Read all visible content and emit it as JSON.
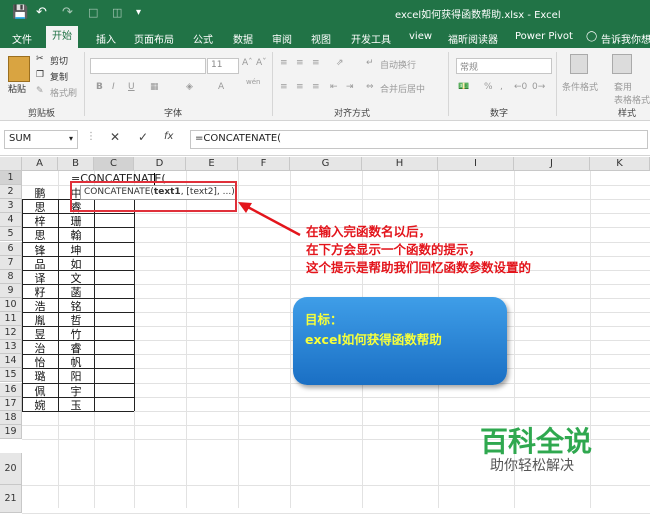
{
  "titlebar": {
    "title": "excel如何获得函数帮助.xlsx - Excel"
  },
  "tabs": [
    "文件",
    "开始",
    "插入",
    "页面布局",
    "公式",
    "数据",
    "审阅",
    "视图",
    "开发工具",
    "view",
    "福昕阅读器",
    "Power Pivot",
    "告诉我你想要"
  ],
  "active_tab": "开始",
  "ribbon": {
    "paste": "粘贴",
    "cut": "剪切",
    "copy": "复制",
    "format_painter": "格式刷",
    "clipboard_group": "剪贴板",
    "font_size": "11",
    "font_group": "字体",
    "wrap_text": "自动换行",
    "merge_center": "合并后居中",
    "alignment_group": "对齐方式",
    "number_format": "常规",
    "percent": "%",
    "comma": ",",
    "number_group": "数字",
    "conditional_format": "条件格式",
    "table_format": "套用\n表格格式",
    "table_format_line1": "套用",
    "table_format_line2": "表格格式",
    "styles_group": "样式",
    "bold": "B",
    "italic": "I",
    "underline": "U",
    "wen": "wén"
  },
  "formula_bar": {
    "name_box": "SUM",
    "fx": "fx",
    "formula": "=CONCATENATE("
  },
  "columns": [
    "A",
    "B",
    "C",
    "D",
    "E",
    "F",
    "G",
    "H",
    "I",
    "J",
    "K"
  ],
  "rows": [
    "1",
    "2",
    "3",
    "4",
    "5",
    "6",
    "7",
    "8",
    "9",
    "10",
    "11",
    "12",
    "13",
    "14",
    "15",
    "16",
    "17",
    "18",
    "19",
    "20",
    "21"
  ],
  "cells": {
    "b1_formula": "=CONCATENATE(",
    "colA": [
      "",
      "鹏",
      "思",
      "梓",
      "思",
      "锋",
      "品",
      "译",
      "籽",
      "浩",
      "胤",
      "昱",
      "治",
      "怡",
      "璐",
      "佩",
      "婉"
    ],
    "colB": [
      "",
      "中",
      "睿",
      "珊",
      "翰",
      "坤",
      "如",
      "文",
      "菡",
      "铭",
      "哲",
      "竹",
      "睿",
      "帆",
      "阳",
      "宇",
      "玉"
    ]
  },
  "tooltip": {
    "func": "CONCATENATE(",
    "arg1": "text1",
    "rest": ", [text2], ...)"
  },
  "annotation": {
    "line1": "在输入完函数名以后，",
    "line2": "在下方会显示一个函数的提示，",
    "line3": "这个提示是帮助我们回忆函数参数设置的"
  },
  "goal": {
    "title": "目标：",
    "text": "excel如何获得函数帮助"
  },
  "watermark": {
    "main": "百科全说",
    "sub": "助你轻松解决"
  },
  "colors": {
    "excel_green": "#217346",
    "annotation_red": "#e3151c",
    "goal_blue": "#2a86d8",
    "goal_text": "#f7ff3a",
    "watermark_green": "#2fa84f"
  }
}
